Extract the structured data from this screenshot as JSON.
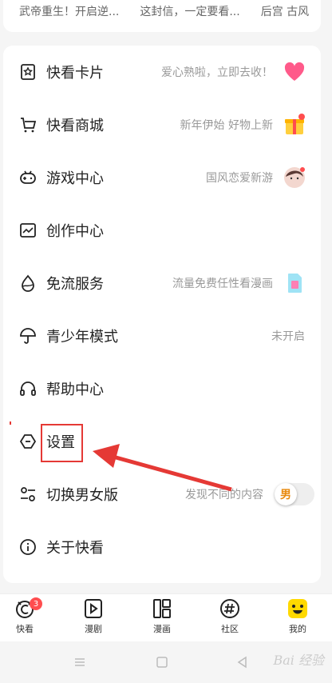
{
  "recent": [
    "武帝重生！开启逆...",
    "这封信，一定要看...",
    "后宫 古风"
  ],
  "menu": [
    {
      "label": "快看卡片",
      "hint": "爱心熟啦，立即去收！",
      "icon": "card-icon",
      "pic": "heart-icon"
    },
    {
      "label": "快看商城",
      "hint": "新年伊始 好物上新",
      "icon": "cart-icon",
      "pic": "gift-icon"
    },
    {
      "label": "游戏中心",
      "hint": "国风恋爱新游",
      "icon": "gamepad-icon",
      "pic": "avatar-icon"
    },
    {
      "label": "创作中心",
      "hint": "",
      "icon": "chart-icon",
      "pic": ""
    },
    {
      "label": "免流服务",
      "hint": "流量免费任性看漫画",
      "icon": "drop-icon",
      "pic": "sim-icon"
    },
    {
      "label": "青少年模式",
      "hint": "未开启",
      "icon": "umbrella-icon",
      "pic": ""
    },
    {
      "label": "帮助中心",
      "hint": "",
      "icon": "headset-icon",
      "pic": ""
    },
    {
      "label": "设置",
      "hint": "",
      "icon": "settings-icon",
      "pic": ""
    },
    {
      "label": "切换男女版",
      "hint": "发现不同的内容",
      "icon": "switch-icon",
      "pic": ""
    },
    {
      "label": "关于快看",
      "hint": "",
      "icon": "info-icon",
      "pic": ""
    }
  ],
  "gender_toggle": {
    "label": "男"
  },
  "nav": [
    {
      "label": "快看",
      "badge": "3"
    },
    {
      "label": "漫剧"
    },
    {
      "label": "漫画"
    },
    {
      "label": "社区"
    },
    {
      "label": "我的"
    }
  ],
  "watermark": "Bai 经验",
  "colors": {
    "accent": "#ffd900",
    "annotation": "#e53935",
    "badge": "#ff4d4f"
  }
}
